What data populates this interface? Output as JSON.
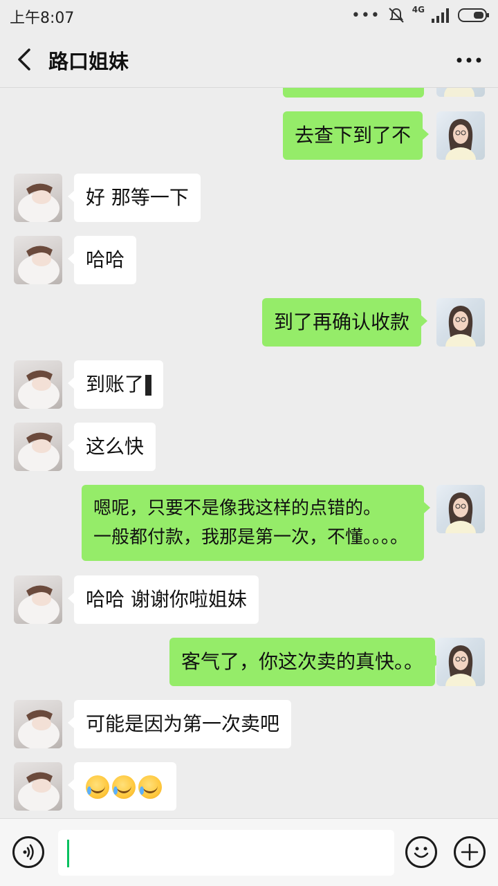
{
  "status_bar": {
    "time": "上午8:07",
    "network": "4G"
  },
  "header": {
    "title": "路口姐妹"
  },
  "messages": [
    {
      "sender": "self",
      "text": "去查下到了不"
    },
    {
      "sender": "other",
      "text": "好 那等一下"
    },
    {
      "sender": "other",
      "text": "哈哈"
    },
    {
      "sender": "self",
      "text": "到了再确认收款"
    },
    {
      "sender": "other",
      "text": "到账了"
    },
    {
      "sender": "other",
      "text": "这么快"
    },
    {
      "sender": "self",
      "lines": [
        "嗯呢，只要不是像我这样的点错的。",
        "一般都付款，我那是第一次，不懂。。。。"
      ]
    },
    {
      "sender": "other",
      "text": "哈哈 谢谢你啦姐妹"
    },
    {
      "sender": "self",
      "text": "客气了，你这次卖的真快。。"
    },
    {
      "sender": "other",
      "text": "可能是因为第一次卖吧"
    },
    {
      "sender": "other",
      "emoji": [
        "face-with-tears-icon",
        "face-with-tears-icon",
        "face-with-tears-icon"
      ]
    }
  ],
  "input": {
    "value": ""
  },
  "colors": {
    "background": "#ededed",
    "outgoing_bubble": "#95ec69",
    "incoming_bubble": "#ffffff",
    "cursor": "#07c160"
  }
}
